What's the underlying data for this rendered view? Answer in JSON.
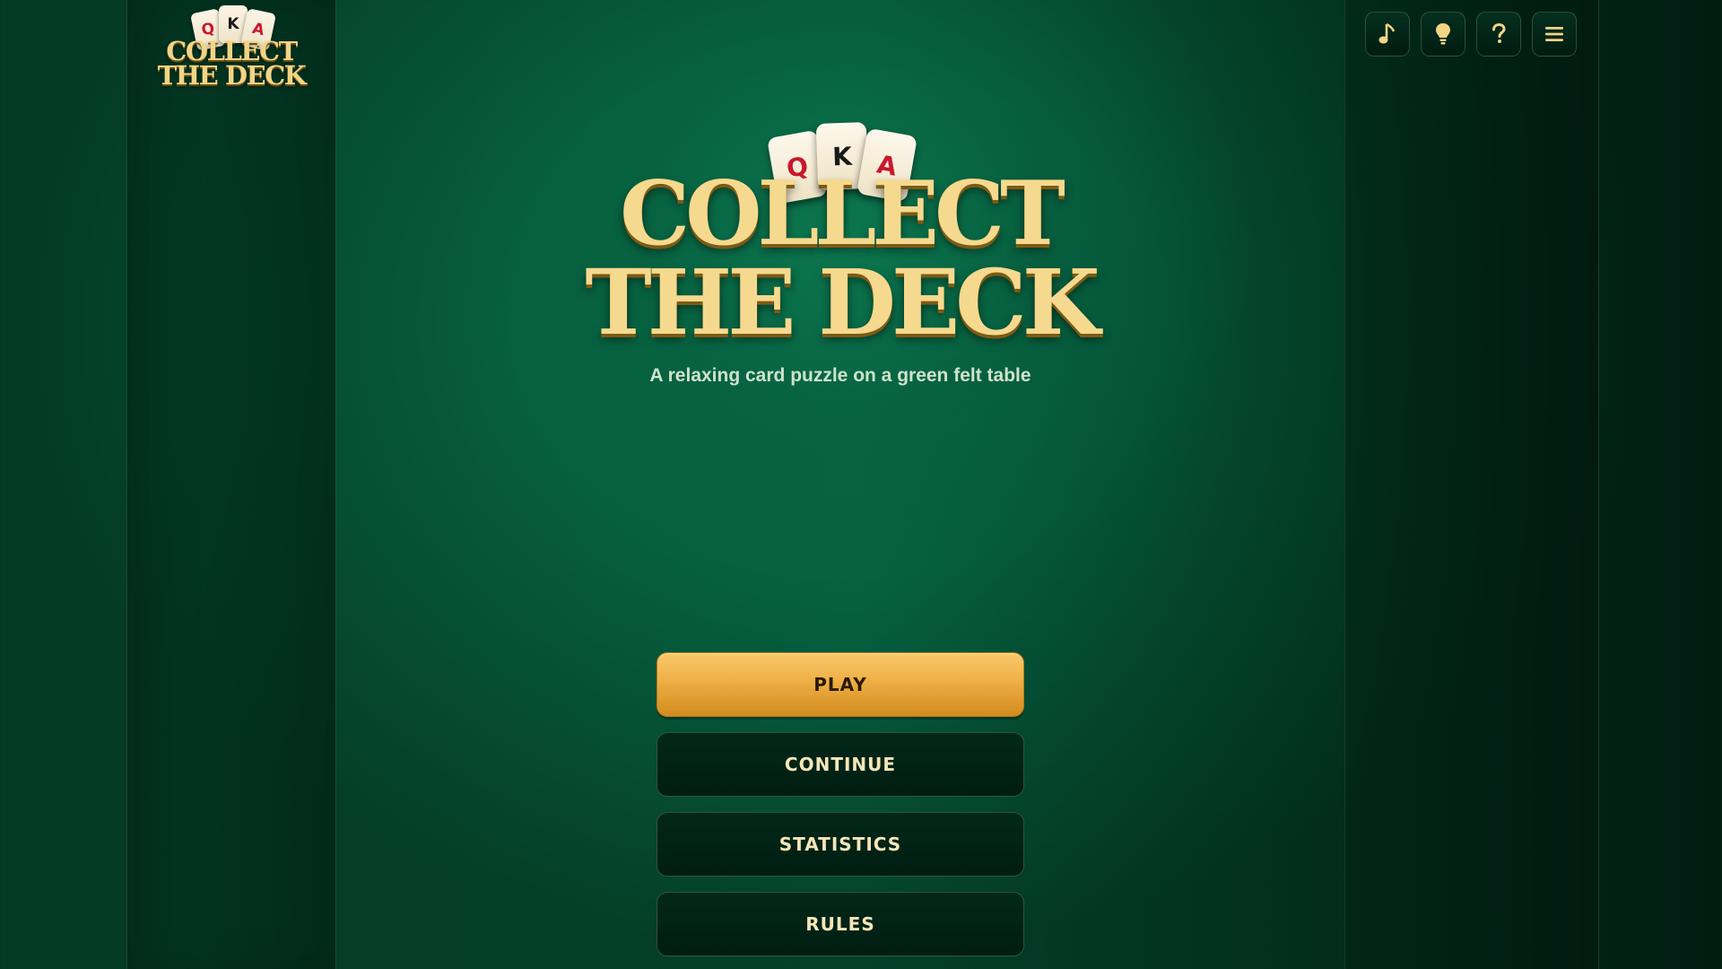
{
  "app": {
    "logo": {
      "cards": [
        "Q",
        "K",
        "A"
      ],
      "title_line1": "COLLECT",
      "title_line2": "THE DECK"
    }
  },
  "toolbar": {
    "music_icon": "music-note-icon",
    "hint_icon": "lightbulb-icon",
    "help_icon": "question-icon",
    "menu_icon": "hamburger-icon"
  },
  "hero": {
    "cards": [
      "Q",
      "K",
      "A"
    ],
    "title_line1": "COLLECT",
    "title_line2": "THE DECK",
    "subtitle": "A relaxing card puzzle on a green felt table"
  },
  "menu": {
    "play": "PLAY",
    "continue": "CONTINUE",
    "statistics": "STATISTICS",
    "rules": "RULES"
  },
  "colors": {
    "felt": "#066241",
    "gold_title": "#f5d98e",
    "primary_button": "#f0b24a",
    "card_red": "#c8182c"
  }
}
